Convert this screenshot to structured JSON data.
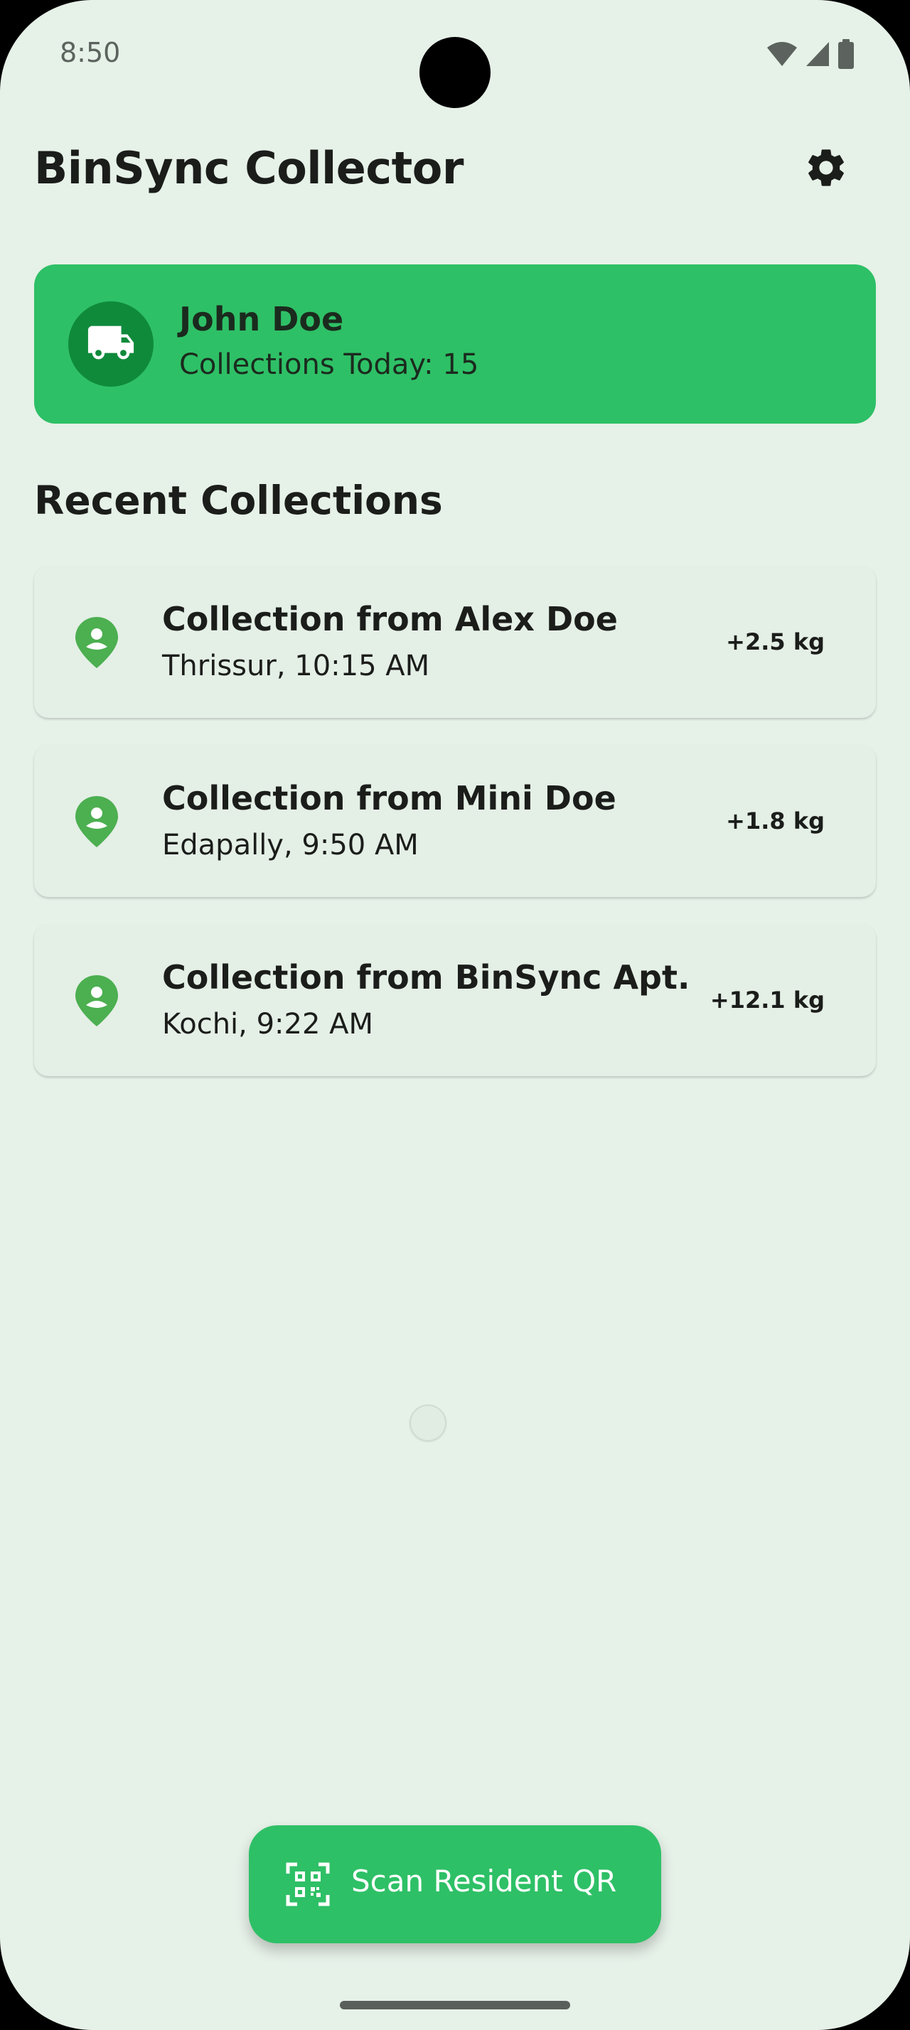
{
  "status_bar": {
    "time": "8:50",
    "icons": [
      "wifi-icon",
      "cellular-signal-icon",
      "battery-icon"
    ]
  },
  "header": {
    "title": "BinSync Collector",
    "settings_icon": "gear-icon"
  },
  "profile": {
    "name": "John Doe",
    "stat": "Collections Today: 15",
    "avatar_icon": "truck-icon"
  },
  "recent": {
    "title": "Recent Collections",
    "items": [
      {
        "title": "Collection from Alex Doe",
        "subtitle": "Thrissur, 10:15 AM",
        "weight": "+2.5 kg",
        "icon": "person-pin-icon"
      },
      {
        "title": "Collection from Mini Doe",
        "subtitle": "Edapally, 9:50 AM",
        "weight": "+1.8 kg",
        "icon": "person-pin-icon"
      },
      {
        "title": "Collection from BinSync Apt.",
        "subtitle": "Kochi, 9:22 AM",
        "weight": "+12.1 kg",
        "icon": "person-pin-icon"
      }
    ]
  },
  "fab": {
    "label": "Scan Resident QR",
    "icon": "qr-scanner-icon"
  },
  "colors": {
    "background": "#e6f1e8",
    "accent": "#2ec066",
    "accent_dark": "#0f8a3b",
    "pin_green": "#4caf50",
    "text": "#1b1d1b"
  }
}
